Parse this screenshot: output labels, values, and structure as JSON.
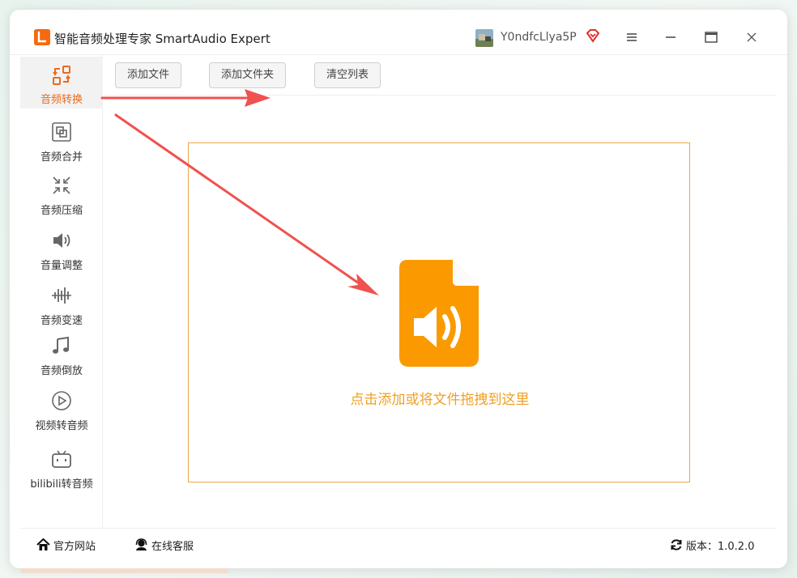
{
  "app": {
    "title": "智能音频处理专家 SmartAudio Expert",
    "username": "Y0ndfcLlya5P",
    "accent_color": "#f56a10",
    "highlight_color": "#f0a024",
    "arrow_color": "#f0524f"
  },
  "sidebar": {
    "items": [
      {
        "label": "音频转换",
        "icon": "convert-icon",
        "active": true
      },
      {
        "label": "音频合并",
        "icon": "merge-icon"
      },
      {
        "label": "音频压缩",
        "icon": "compress-icon"
      },
      {
        "label": "音量调整",
        "icon": "volume-icon"
      },
      {
        "label": "音频变速",
        "icon": "speed-icon"
      },
      {
        "label": "音频倒放",
        "icon": "music-note-icon"
      },
      {
        "label": "视频转音频",
        "icon": "play-icon"
      },
      {
        "label": "bilibili转音频",
        "icon": "bilibili-icon"
      }
    ]
  },
  "toolbar": {
    "add_file": "添加文件",
    "add_folder": "添加文件夹",
    "clear_list": "清空列表"
  },
  "dropzone": {
    "prompt": "点击添加或将文件拖拽到这里",
    "icon": "audio-file-icon"
  },
  "footer": {
    "website": "官方网站",
    "support": "在线客服",
    "version": "版本：1.0.2.0"
  }
}
